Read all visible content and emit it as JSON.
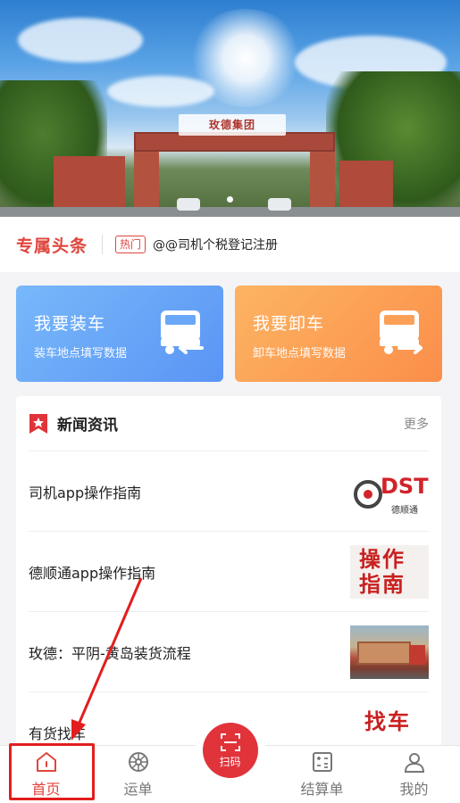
{
  "banner": {
    "sign_text": "玫德集团"
  },
  "headline": {
    "title": "专属头条",
    "badge": "热门",
    "text": "@@司机个税登记注册"
  },
  "cards": [
    {
      "title": "我要装车",
      "subtitle": "装车地点填写数据",
      "icon": "truck-arrow-left-icon"
    },
    {
      "title": "我要卸车",
      "subtitle": "卸车地点填写数据",
      "icon": "truck-arrow-right-icon"
    }
  ],
  "news": {
    "title": "新闻资讯",
    "more": "更多",
    "items": [
      {
        "title": "司机app操作指南",
        "thumb_text": "DST",
        "thumb_sub": "德顺通"
      },
      {
        "title": "德顺通app操作指南",
        "thumb_text": "操作指南"
      },
      {
        "title": "玫德：平阴-黄岛装货流程"
      },
      {
        "title": "有货找车",
        "thumb_text": "找车"
      }
    ]
  },
  "tabbar": {
    "tabs": [
      {
        "label": "首页",
        "icon": "home-icon",
        "active": true
      },
      {
        "label": "运单",
        "icon": "waybill-icon"
      },
      {
        "label": "扫码",
        "icon": "scan-icon"
      },
      {
        "label": "结算单",
        "icon": "settlement-icon"
      },
      {
        "label": "我的",
        "icon": "user-icon"
      }
    ]
  },
  "colors": {
    "accent": "#e0453d",
    "load_card": "#5a95f5",
    "unload_card": "#fb8e4a",
    "annotation": "#e21e1e"
  }
}
